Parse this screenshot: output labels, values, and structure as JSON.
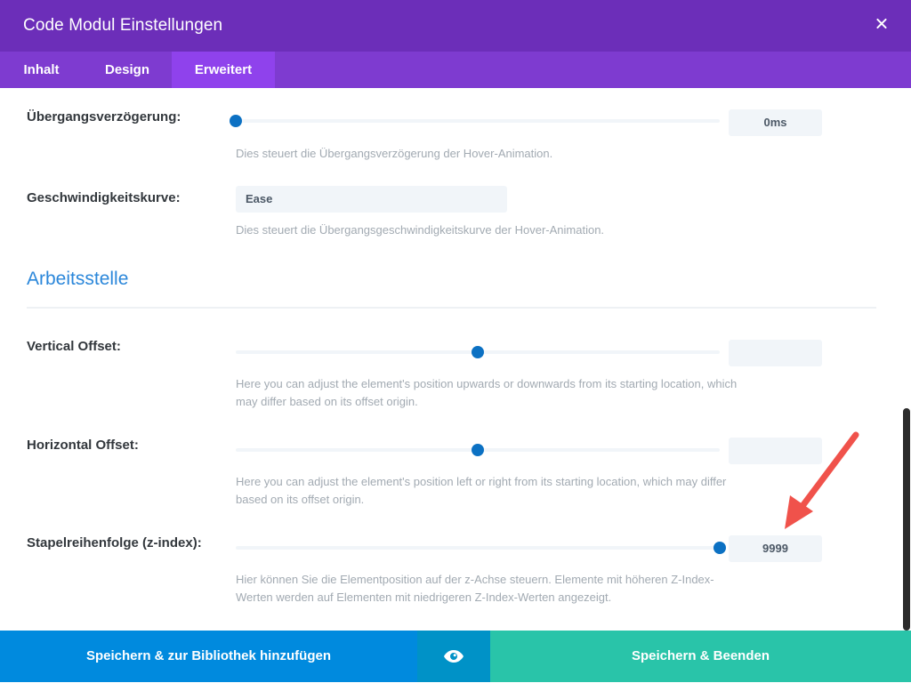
{
  "header": {
    "title": "Code Modul Einstellungen",
    "close_icon": "close-icon"
  },
  "tabs": [
    {
      "label": "Inhalt",
      "active": false
    },
    {
      "label": "Design",
      "active": false
    },
    {
      "label": "Erweitert",
      "active": true
    }
  ],
  "fields": {
    "transition_delay": {
      "label": "Übergangsverzögerung:",
      "value": "0ms",
      "slider_fraction": 0.0,
      "description": "Dies steuert die Übergangsverzögerung der Hover-Animation."
    },
    "speed_curve": {
      "label": "Geschwindigkeitskurve:",
      "value": "Ease",
      "description": "Dies steuert die Übergangsgeschwindigkeitskurve der Hover-Animation."
    },
    "section_title": "Arbeitsstelle",
    "vertical_offset": {
      "label": "Vertical Offset:",
      "value": "",
      "slider_fraction": 0.5,
      "description": "Here you can adjust the element's position upwards or downwards from its starting location, which may differ based on its offset origin."
    },
    "horizontal_offset": {
      "label": "Horizontal Offset:",
      "value": "",
      "slider_fraction": 0.5,
      "description": "Here you can adjust the element's position left or right from its starting location, which may differ based on its offset origin."
    },
    "z_index": {
      "label": "Stapelreihenfolge (z-index):",
      "value": "9999",
      "slider_fraction": 1.0,
      "description": "Hier können Sie die Elementposition auf der z-Achse steuern. Elemente mit höheren Z-Index-Werten werden auf Elementen mit niedrigeren Z-Index-Werten angezeigt."
    }
  },
  "footer": {
    "save_library_label": "Speichern & zur Bibliothek hinzufügen",
    "preview_icon": "eye-icon",
    "save_exit_label": "Speichern & Beenden"
  },
  "colors": {
    "header": "#6c2eb9",
    "tabs": "#7e3bd0",
    "active_tab": "#8f42ec",
    "accent_blue": "#0c71c3",
    "section_title": "#2b87da",
    "btn_library": "#008ade",
    "btn_preview": "#0092c7",
    "btn_save": "#29c4a9",
    "arrow": "#f0524b"
  }
}
